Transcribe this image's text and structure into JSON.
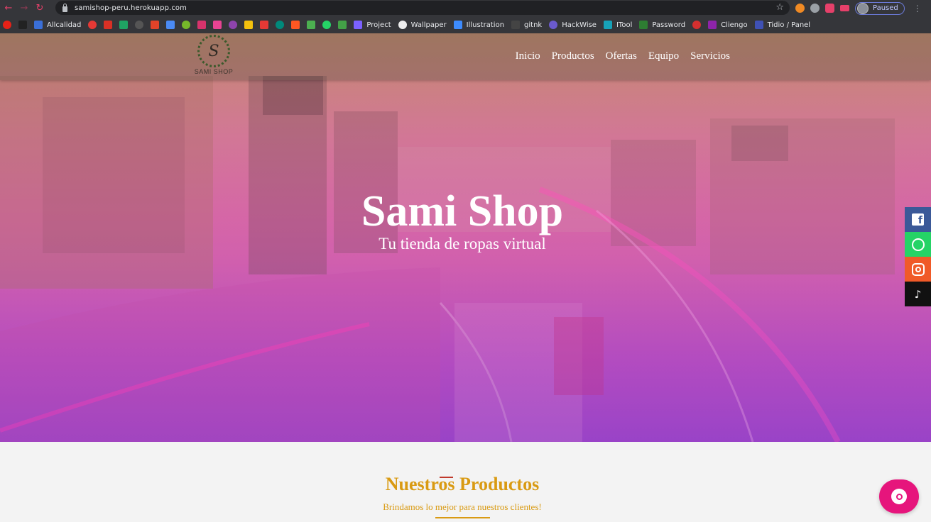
{
  "browser": {
    "url": "samishop-peru.herokuapp.com",
    "profile_status": "Paused",
    "bookmarks": [
      {
        "label": "",
        "color": "#e62117"
      },
      {
        "label": "",
        "color": "#222222"
      },
      {
        "label": "Allcalidad",
        "color": "#3a6fd8"
      },
      {
        "label": "",
        "color": "#e53935"
      },
      {
        "label": "",
        "color": "#d93025"
      },
      {
        "label": "",
        "color": "#1fa463"
      },
      {
        "label": "",
        "color": "#555555"
      },
      {
        "label": "",
        "color": "#e24329"
      },
      {
        "label": "",
        "color": "#4a8af4"
      },
      {
        "label": "",
        "color": "#76b82a"
      },
      {
        "label": "",
        "color": "#d6336c"
      },
      {
        "label": "",
        "color": "#e84393"
      },
      {
        "label": "",
        "color": "#8e44ad"
      },
      {
        "label": "",
        "color": "#f4c20d"
      },
      {
        "label": "",
        "color": "#e53935"
      },
      {
        "label": "",
        "color": "#00897b"
      },
      {
        "label": "",
        "color": "#ff5722"
      },
      {
        "label": "",
        "color": "#4caf50"
      },
      {
        "label": "",
        "color": "#25d366"
      },
      {
        "label": "",
        "color": "#43a047"
      },
      {
        "label": "Project",
        "color": "#7b61ff"
      },
      {
        "label": "Wallpaper",
        "color": "#eeeeee"
      },
      {
        "label": "Illustration",
        "color": "#3d8bfd"
      },
      {
        "label": "gitnk",
        "color": "#444444"
      },
      {
        "label": "HackWise",
        "color": "#6a5acd"
      },
      {
        "label": "ITool",
        "color": "#17a2b8"
      },
      {
        "label": "Password",
        "color": "#2e7d32"
      },
      {
        "label": "",
        "color": "#d32f2f"
      },
      {
        "label": "Cliengo",
        "color": "#8e24aa"
      },
      {
        "label": "Tidio / Panel",
        "color": "#3f51b5"
      }
    ]
  },
  "site": {
    "logo_letter": "S",
    "logo_text": "SAMI SHOP",
    "nav": [
      "Inicio",
      "Productos",
      "Ofertas",
      "Equipo",
      "Servicios"
    ],
    "hero_title": "Sami Shop",
    "hero_subtitle": "Tu tienda de ropas virtual",
    "social": [
      "facebook-icon",
      "whatsapp-icon",
      "instagram-icon",
      "tiktok-icon"
    ],
    "section_title": "Nuestros Productos",
    "section_subtitle": "Brindamos lo mejor para nuestros clientes!",
    "accent_color": "#d99a12",
    "chat_color": "#e6157c"
  }
}
